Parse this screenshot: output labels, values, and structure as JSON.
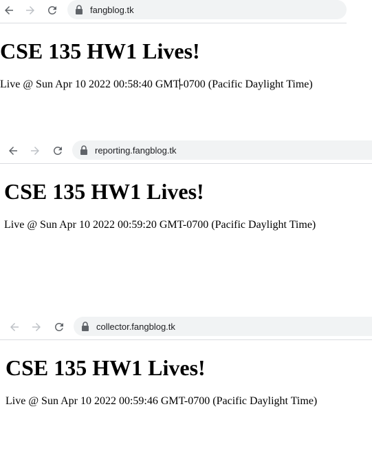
{
  "colors": {
    "omnibox_bg": "#f1f3f4",
    "icon_enabled": "#5f6368",
    "icon_disabled": "#bdc1c6",
    "divider": "#dadce0"
  },
  "windows": [
    {
      "url": "fangblog.tk",
      "heading": "CSE 135 HW1 Lives!",
      "status_part1": "Live @ Sun Apr 10 2022 00:58:40 GMT",
      "status_part2": "-0700 (Pacific Daylight Time)",
      "back_enabled": true,
      "forward_enabled": false
    },
    {
      "url": "reporting.fangblog.tk",
      "heading": "CSE 135 HW1 Lives!",
      "status": "Live @ Sun Apr 10 2022 00:59:20 GMT-0700 (Pacific Daylight Time)",
      "back_enabled": true,
      "forward_enabled": false
    },
    {
      "url": "collector.fangblog.tk",
      "heading": "CSE 135 HW1 Lives!",
      "status": "Live @ Sun Apr 10 2022 00:59:46 GMT-0700 (Pacific Daylight Time)",
      "back_enabled": false,
      "forward_enabled": false
    }
  ],
  "icons": {
    "back": "back-arrow-icon",
    "forward": "forward-arrow-icon",
    "reload": "reload-icon",
    "lock": "lock-icon"
  }
}
